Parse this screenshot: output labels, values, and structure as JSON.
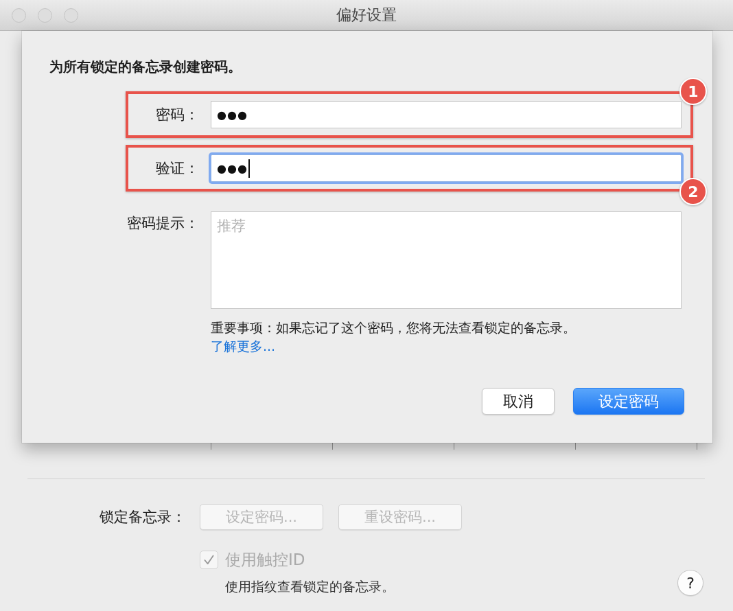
{
  "window": {
    "title": "偏好设置",
    "buttons": [
      {
        "disabled": true
      },
      {
        "disabled": true
      },
      {
        "disabled": true
      }
    ]
  },
  "sheet": {
    "heading": "为所有锁定的备忘录创建密码。",
    "fields": [
      {
        "kind": "password",
        "label": "密码：",
        "value": "●●●",
        "focused": false,
        "callout": {
          "number": "1",
          "kind": "top"
        }
      },
      {
        "kind": "password",
        "label": "验证：",
        "value": "●●●",
        "focused": true,
        "callout": {
          "number": "2",
          "kind": "bottom"
        }
      },
      {
        "kind": "multiline",
        "label": "密码提示：",
        "placeholder": "推荐",
        "focused": false
      }
    ],
    "note": "重要事项：如果忘记了这个密码，您将无法查看锁定的备忘录。",
    "link": "了解更多...",
    "buttons": [
      {
        "label": "取消",
        "default": false
      },
      {
        "label": "设定密码",
        "default": true
      }
    ]
  },
  "lock_notes": {
    "label": "锁定备忘录：",
    "buttons": [
      {
        "label": "设定密码...",
        "disabled": true
      },
      {
        "label": "重设密码...",
        "disabled": true
      }
    ],
    "touch_id": {
      "label": "使用触控ID",
      "checked": true,
      "disabled": true
    },
    "description": "使用指纹查看锁定的备忘录。"
  },
  "help": {
    "label": "?"
  }
}
